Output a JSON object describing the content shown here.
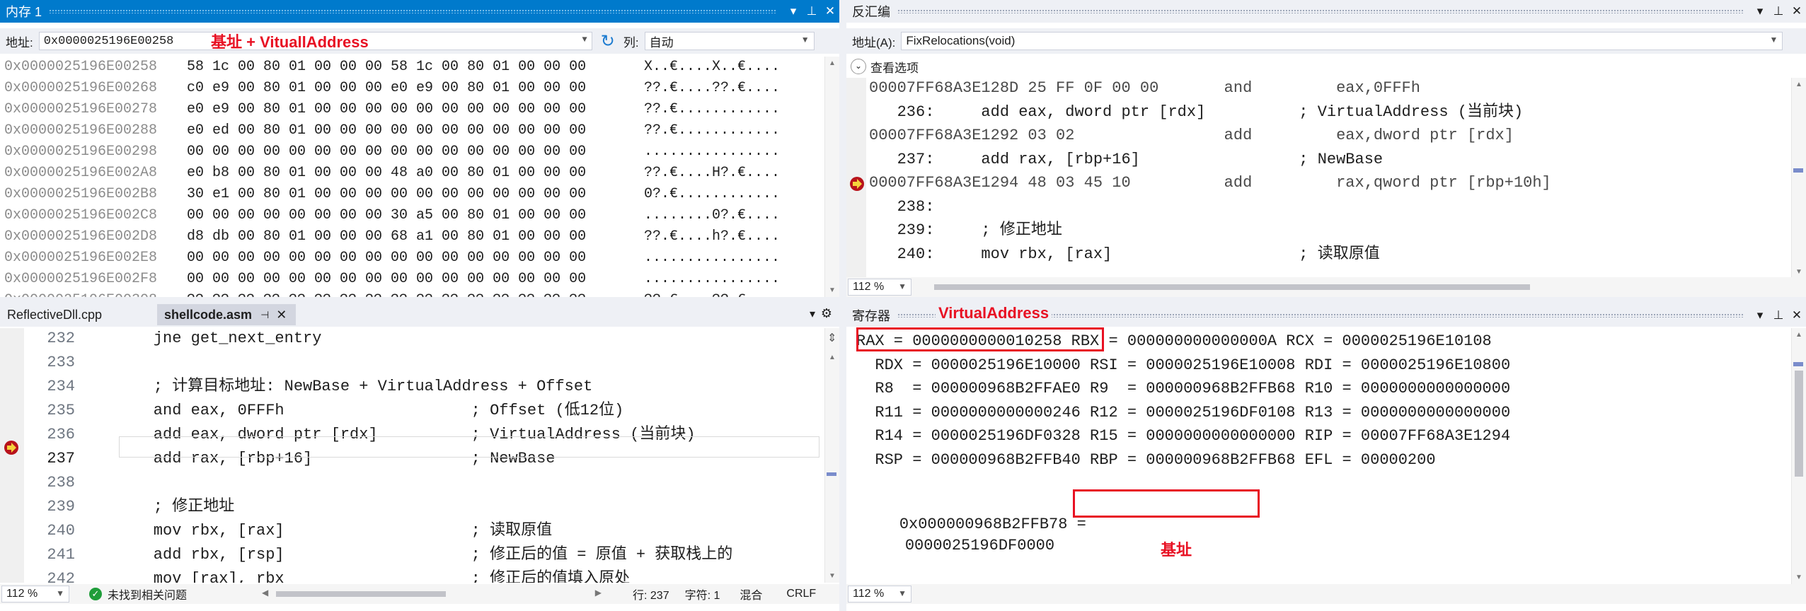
{
  "memory": {
    "title": "内存 1",
    "address_label": "地址:",
    "address_value": "0x0000025196E00258",
    "column_label": "列:",
    "column_value": "自动",
    "rows": [
      {
        "addr": "0x0000025196E00258",
        "bytes": "58 1c 00 80 01 00 00 00 58 1c 00 80 01 00 00 00",
        "ascii": "X..€....X..€...."
      },
      {
        "addr": "0x0000025196E00268",
        "bytes": "c0 e9 00 80 01 00 00 00 e0 e9 00 80 01 00 00 00",
        "ascii": "??.€....??.€...."
      },
      {
        "addr": "0x0000025196E00278",
        "bytes": "e0 e9 00 80 01 00 00 00 00 00 00 00 00 00 00 00",
        "ascii": "??.€............"
      },
      {
        "addr": "0x0000025196E00288",
        "bytes": "e0 ed 00 80 01 00 00 00 00 00 00 00 00 00 00 00",
        "ascii": "??.€............"
      },
      {
        "addr": "0x0000025196E00298",
        "bytes": "00 00 00 00 00 00 00 00 00 00 00 00 00 00 00 00",
        "ascii": "................"
      },
      {
        "addr": "0x0000025196E002A8",
        "bytes": "e0 b8 00 80 01 00 00 00 48 a0 00 80 01 00 00 00",
        "ascii": "??.€....H?.€...."
      },
      {
        "addr": "0x0000025196E002B8",
        "bytes": "30 e1 00 80 01 00 00 00 00 00 00 00 00 00 00 00",
        "ascii": "0?.€............"
      },
      {
        "addr": "0x0000025196E002C8",
        "bytes": "00 00 00 00 00 00 00 00 30 a5 00 80 01 00 00 00",
        "ascii": "........0?.€...."
      },
      {
        "addr": "0x0000025196E002D8",
        "bytes": "d8 db 00 80 01 00 00 00 68 a1 00 80 01 00 00 00",
        "ascii": "??.€....h?.€...."
      },
      {
        "addr": "0x0000025196E002E8",
        "bytes": "00 00 00 00 00 00 00 00 00 00 00 00 00 00 00 00",
        "ascii": "................"
      },
      {
        "addr": "0x0000025196E002F8",
        "bytes": "00 00 00 00 00 00 00 00 00 00 00 00 00 00 00 00",
        "ascii": "................"
      },
      {
        "addr": "0x0000025196E00308",
        "bytes": "?? ?? ?? ?? ?? ?? ?? ?? ?? ?? ?? ?? ?? ?? ?? ??",
        "ascii": "??.€....??.€...."
      }
    ],
    "annotation": "基址 + VituallAddress"
  },
  "disasm": {
    "title": "反汇编",
    "address_label": "地址(A):",
    "address_value": "FixRelocations(void)",
    "view_options": "查看选项",
    "lines": [
      {
        "text": "00007FF68A3E128D 25 FF 0F 00 00       and         eax,0FFFh",
        "kind": "asm"
      },
      {
        "text": "   236:     add eax, dword ptr [rdx]          ; VirtualAddress (当前块)",
        "kind": "src"
      },
      {
        "text": "00007FF68A3E1292 03 02                add         eax,dword ptr [rdx]",
        "kind": "asm"
      },
      {
        "text": "   237:     add rax, [rbp+16]                 ; NewBase",
        "kind": "src"
      },
      {
        "text": "00007FF68A3E1294 48 03 45 10          add         rax,qword ptr [rbp+10h]",
        "kind": "asm"
      },
      {
        "text": "   238:",
        "kind": "src"
      },
      {
        "text": "   239:     ; 修正地址",
        "kind": "src"
      },
      {
        "text": "   240:     mov rbx, [rax]                    ; 读取原值",
        "kind": "src"
      }
    ],
    "zoom": "112 %"
  },
  "editor": {
    "tab_inactive": "ReflectiveDll.cpp",
    "tab_active": "shellcode.asm",
    "lines": [
      {
        "num": "232",
        "text": "    jne get_next_entry"
      },
      {
        "num": "233",
        "text": ""
      },
      {
        "num": "234",
        "text": "    ; 计算目标地址: NewBase + VirtualAddress + Offset"
      },
      {
        "num": "235",
        "text": "    and eax, 0FFFh                    ; Offset (低12位)"
      },
      {
        "num": "236",
        "text": "    add eax, dword ptr [rdx]          ; VirtualAddress (当前块)"
      },
      {
        "num": "237",
        "text": "    add rax, [rbp+16]                 ; NewBase"
      },
      {
        "num": "238",
        "text": ""
      },
      {
        "num": "239",
        "text": "    ; 修正地址"
      },
      {
        "num": "240",
        "text": "    mov rbx, [rax]                    ; 读取原值"
      },
      {
        "num": "241",
        "text": "    add rbx, [rsp]                    ; 修正后的值 = 原值 + 获取栈上的"
      },
      {
        "num": "242",
        "text": "    mov [rax], rbx                    ; 修正后的值填入原处"
      }
    ],
    "status": {
      "zoom": "112 %",
      "issues": "未找到相关问题",
      "line": "行: 237",
      "col": "字符: 1",
      "mixed": "混合",
      "eol": "CRLF"
    }
  },
  "registers": {
    "title": "寄存器",
    "annotation_top": "VirtualAddress",
    "lines": [
      "RAX = 0000000000010258 RBX = 000000000000000A RCX = 0000025196E10108",
      "  RDX = 0000025196E10000 RSI = 0000025196E10008 RDI = 0000025196E10800",
      "  R8  = 000000968B2FFAE0 R9  = 000000968B2FFB68 R10 = 0000000000000000",
      "  R11 = 0000000000000246 R12 = 0000025196DF0108 R13 = 0000000000000000",
      "  R14 = 0000025196DF0328 R15 = 0000000000000000 RIP = 00007FF68A3E1294",
      "  RSP = 000000968B2FFB40 RBP = 000000968B2FFB68 EFL = 00000200"
    ],
    "watch_expr": "0x000000968B2FFB78 =",
    "watch_value": "0000025196DF0000",
    "annotation_bottom": "基址",
    "zoom": "112 %"
  }
}
